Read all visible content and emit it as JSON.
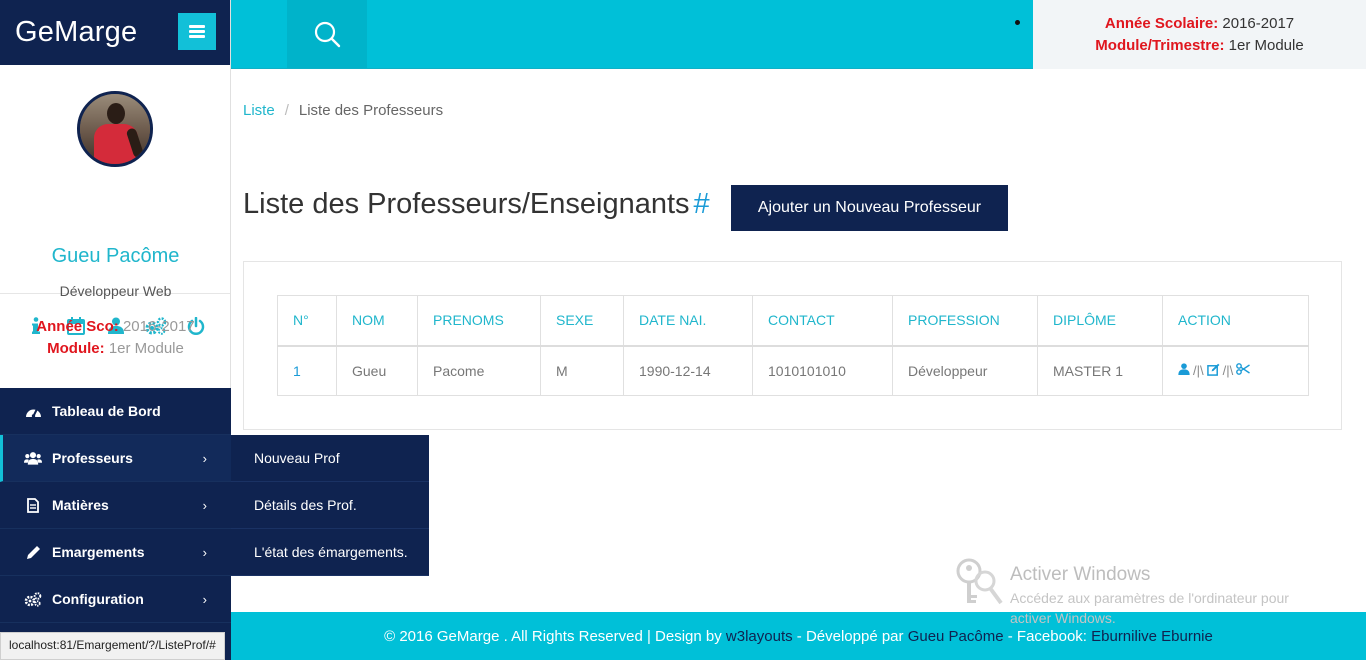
{
  "brand": {
    "name": "GeMarge"
  },
  "profile": {
    "name": "Gueu Pacôme",
    "role": "Développeur Web",
    "icons": [
      "info-icon",
      "calendar-icon",
      "user-icon",
      "cogs-icon",
      "power-icon"
    ]
  },
  "sidebar_session": {
    "year_label": "Année Sco:",
    "year_value": "2016-2017",
    "module_label": "Module:",
    "module_value": "1er Module"
  },
  "nav": {
    "items": [
      {
        "label": "Tableau de Bord",
        "icon": "dashboard-icon"
      },
      {
        "label": "Professeurs",
        "icon": "users-icon"
      },
      {
        "label": "Matières",
        "icon": "file-icon"
      },
      {
        "label": "Emargements",
        "icon": "pencil-icon"
      },
      {
        "label": "Configuration",
        "icon": "cogs-icon"
      }
    ],
    "chevron": "›"
  },
  "submenu": {
    "items": [
      "Nouveau Prof",
      "Détails des Prof.",
      "L'état des émargements."
    ]
  },
  "topbar": {
    "year_label": "Année Scolaire:",
    "year_value": "2016-2017",
    "module_label": "Module/Trimestre:",
    "module_value": "1er Module"
  },
  "breadcrumb": {
    "link": "Liste",
    "separator": "/",
    "current": "Liste des Professeurs"
  },
  "page": {
    "title": "Liste des Professeurs/Enseignants",
    "hash": "#",
    "add_button": "Ajouter un Nouveau Professeur"
  },
  "table": {
    "headers": [
      "N°",
      "NOM",
      "PRENOMS",
      "SEXE",
      "DATE NAI.",
      "CONTACT",
      "PROFESSION",
      "DIPLÔME",
      "ACTION"
    ],
    "rows": [
      {
        "num": "1",
        "nom": "Gueu",
        "prenoms": "Pacome",
        "sexe": "M",
        "date": "1990-12-14",
        "contact": "1010101010",
        "profession": "Développeur",
        "diplome": "MASTER 1",
        "sep": "/|\\"
      }
    ]
  },
  "status_url": "localhost:81/Emargement/?/ListeProf/#",
  "watermark": {
    "title": "Activer Windows",
    "subtitle": "Accédez aux paramètres de l'ordinateur pour activer Windows."
  },
  "footer": {
    "part1": "© 2016 GeMarge . All Rights Reserved | Design by ",
    "design_link": "w3layouts",
    "part2": " - Développé par ",
    "dev_link": "Gueu Pacôme",
    "part3": " - Facebook: ",
    "fb_link": "Eburnilive Eburnie"
  },
  "colors": {
    "navy": "#0f2350",
    "cyan": "#00c0d8",
    "accent_text": "#20b6cc",
    "red": "#e0161e"
  }
}
